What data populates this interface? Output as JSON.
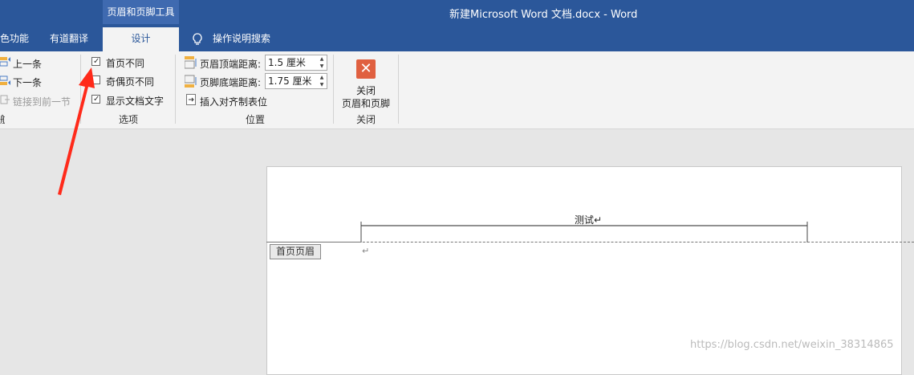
{
  "titlebar": {
    "context_tool": "页眉和页脚工具",
    "document_title": "新建Microsoft Word 文档.docx  -  Word"
  },
  "tabs": [
    {
      "label": "色功能"
    },
    {
      "label": "有道翻译"
    },
    {
      "label": "设计",
      "active": true
    },
    {
      "label": "操作说明搜索"
    }
  ],
  "ribbon": {
    "nav": {
      "prev": "上一条",
      "next": "下一条",
      "link_prev": "链接到前一节",
      "group_label": "航"
    },
    "options": {
      "first_page_diff": {
        "label": "首页不同",
        "checked": true
      },
      "odd_even_diff": {
        "label": "奇偶页不同",
        "checked": false
      },
      "show_doc_text": {
        "label": "显示文档文字",
        "checked": true
      },
      "group_label": "选项"
    },
    "position": {
      "header_top_label": "页眉顶端距离:",
      "header_top_value": "1.5 厘米",
      "footer_bottom_label": "页脚底端距离:",
      "footer_bottom_value": "1.75 厘米",
      "insert_align_tab": "插入对齐制表位",
      "group_label": "位置"
    },
    "close": {
      "line1": "关闭",
      "line2": "页眉和页脚",
      "group_label": "关闭"
    }
  },
  "document": {
    "header_text": "测试↵",
    "header_tag": "首页页眉",
    "para_mark": "↵"
  },
  "watermark": "https://blog.csdn.net/weixin_38314865",
  "colors": {
    "accent": "#2b579a",
    "annotation_arrow": "#ff2a1a",
    "close_icon": "#e06040"
  }
}
